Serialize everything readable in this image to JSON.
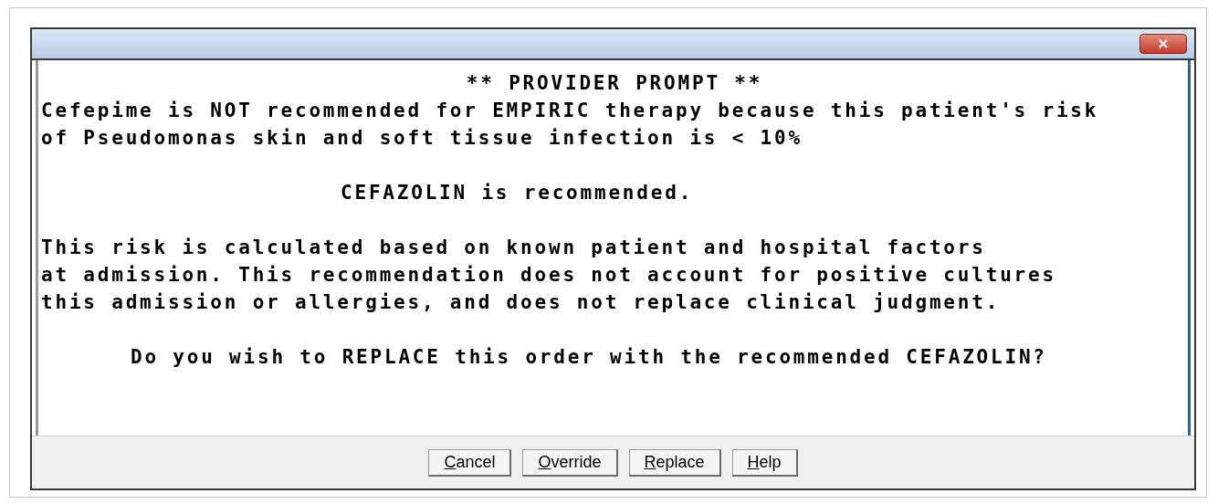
{
  "window": {
    "title": "** PROVIDER PROMPT **"
  },
  "paragraphs": [
    {
      "lines": [
        "Cefepime is NOT recommended for EMPIRIC therapy because this patient's risk",
        "of Pseudomonas skin and soft tissue infection is < 10%"
      ]
    },
    {
      "lines": [
        "CEFAZOLIN is recommended."
      ]
    },
    {
      "lines": [
        "This risk is calculated based on known patient and hospital factors",
        "at admission. This recommendation does not account for positive cultures",
        "this admission or allergies, and does not replace clinical judgment."
      ]
    },
    {
      "lines": [
        "Do you wish to REPLACE this order with the recommended CEFAZOLIN?"
      ]
    }
  ],
  "buttons": [
    {
      "label": "Cancel"
    },
    {
      "label": "Override"
    },
    {
      "label": "Replace"
    },
    {
      "label": "Help"
    }
  ]
}
